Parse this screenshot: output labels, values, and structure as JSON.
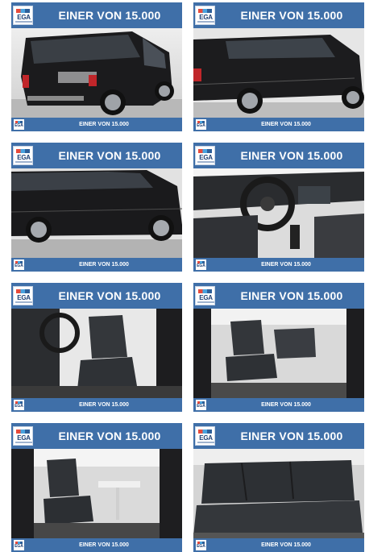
{
  "brand": {
    "logo_text": "EGA",
    "colors": {
      "header": "#3f6fa8",
      "logo_text": "#1d3f73"
    }
  },
  "cards": [
    {
      "headline": "EINER VON 15.000",
      "footer": "EINER VON 15.000",
      "scene": "van-rear-quarter"
    },
    {
      "headline": "EINER VON 15.000",
      "footer": "EINER VON 15.000",
      "scene": "van-side-rear"
    },
    {
      "headline": "EINER VON 15.000",
      "footer": "EINER VON 15.000",
      "scene": "van-side"
    },
    {
      "headline": "EINER VON 15.000",
      "footer": "EINER VON 15.000",
      "scene": "dashboard-interior"
    },
    {
      "headline": "EINER VON 15.000",
      "footer": "EINER VON 15.000",
      "scene": "front-seats"
    },
    {
      "headline": "EINER VON 15.000",
      "footer": "EINER VON 15.000",
      "scene": "rear-seats-door-view"
    },
    {
      "headline": "EINER VON 15.000",
      "footer": "EINER VON 15.000",
      "scene": "rear-seats-with-table"
    },
    {
      "headline": "EINER VON 15.000",
      "footer": "EINER VON 15.000",
      "scene": "rear-bench-seats"
    }
  ]
}
